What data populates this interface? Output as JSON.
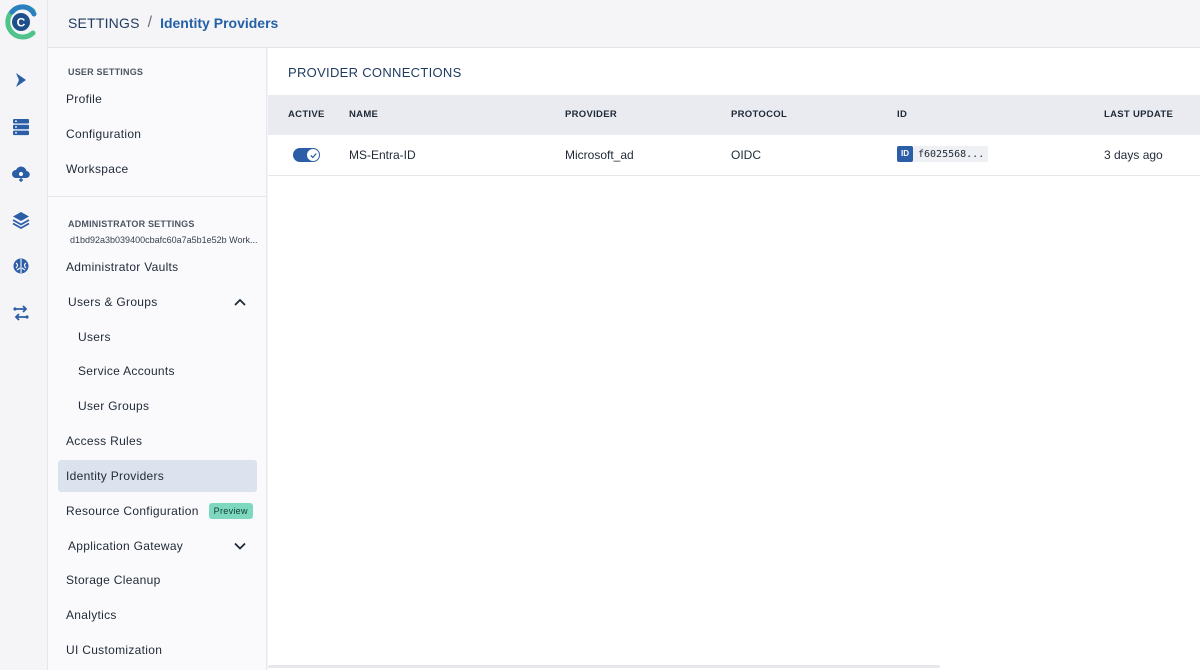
{
  "app": {
    "logo_letter": "C"
  },
  "rail": {
    "icons": [
      "chevron-right-icon",
      "server-icon",
      "cloud-settings-icon",
      "layers-icon",
      "brain-icon",
      "transfer-icon"
    ]
  },
  "breadcrumb": {
    "root": "SETTINGS",
    "separator": "/",
    "current": "Identity Providers"
  },
  "sidebar": {
    "user_section_label": "USER SETTINGS",
    "user_items": [
      "Profile",
      "Configuration",
      "Workspace"
    ],
    "admin_section_label": "ADMINISTRATOR SETTINGS",
    "workspace_id": "d1bd92a3b039400cbafc60a7a5b1e52b Work...",
    "admin_items": {
      "vaults": "Administrator Vaults",
      "users_groups": "Users & Groups",
      "users": "Users",
      "service_accounts": "Service Accounts",
      "user_groups": "User Groups",
      "access_rules": "Access Rules",
      "identity_providers": "Identity Providers",
      "resource_configuration": "Resource Configuration",
      "preview_badge": "Preview",
      "application_gateway": "Application Gateway",
      "storage_cleanup": "Storage Cleanup",
      "analytics": "Analytics",
      "ui_customization": "UI Customization"
    }
  },
  "main": {
    "title": "PROVIDER CONNECTIONS",
    "columns": {
      "active": "ACTIVE",
      "name": "NAME",
      "provider": "PROVIDER",
      "protocol": "PROTOCOL",
      "id": "ID",
      "last_update": "LAST UPDATE"
    },
    "rows": [
      {
        "active": true,
        "name": "MS-Entra-ID",
        "provider": "Microsoft_ad",
        "protocol": "OIDC",
        "id_tag": "ID",
        "id": "f6025568...",
        "last_update": "3 days ago"
      }
    ]
  },
  "colors": {
    "accent": "#2c5ea8",
    "breadcrumb_current": "#2460a7",
    "badge_bg": "#7dd8bf",
    "active_nav_bg": "#dde3ee"
  }
}
